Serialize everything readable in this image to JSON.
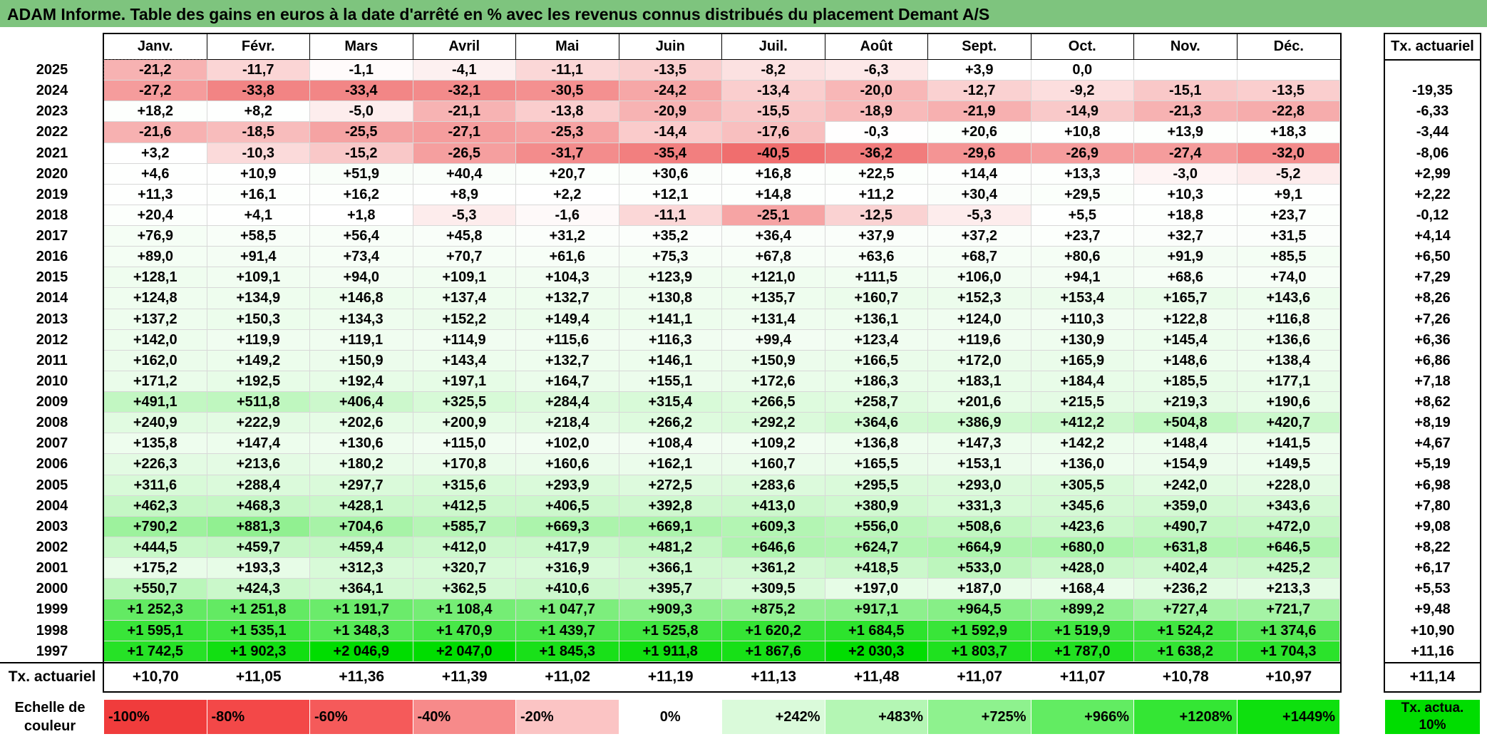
{
  "title": "ADAM Informe. Table des gains en euros à la date d'arrêté en % avec les revenus connus distribués du placement Demant A/S",
  "months": [
    "Janv.",
    "Févr.",
    "Mars",
    "Avril",
    "Mai",
    "Juin",
    "Juil.",
    "Août",
    "Sept.",
    "Oct.",
    "Nov.",
    "Déc."
  ],
  "tx_header": "Tx. actuariel",
  "rows": [
    {
      "year": "2025",
      "cells": [
        "-21,2",
        "-11,7",
        "-1,1",
        "-4,1",
        "-11,1",
        "-13,5",
        "-8,2",
        "-6,3",
        "+3,9",
        "0,0",
        "",
        ""
      ],
      "tx": ""
    },
    {
      "year": "2024",
      "cells": [
        "-27,2",
        "-33,8",
        "-33,4",
        "-32,1",
        "-30,5",
        "-24,2",
        "-13,4",
        "-20,0",
        "-12,7",
        "-9,2",
        "-15,1",
        "-13,5"
      ],
      "tx": "-19,35"
    },
    {
      "year": "2023",
      "cells": [
        "+18,2",
        "+8,2",
        "-5,0",
        "-21,1",
        "-13,8",
        "-20,9",
        "-15,5",
        "-18,9",
        "-21,9",
        "-14,9",
        "-21,3",
        "-22,8"
      ],
      "tx": "-6,33"
    },
    {
      "year": "2022",
      "cells": [
        "-21,6",
        "-18,5",
        "-25,5",
        "-27,1",
        "-25,3",
        "-14,4",
        "-17,6",
        "-0,3",
        "+20,6",
        "+10,8",
        "+13,9",
        "+18,3"
      ],
      "tx": "-3,44"
    },
    {
      "year": "2021",
      "cells": [
        "+3,2",
        "-10,3",
        "-15,2",
        "-26,5",
        "-31,7",
        "-35,4",
        "-40,5",
        "-36,2",
        "-29,6",
        "-26,9",
        "-27,4",
        "-32,0"
      ],
      "tx": "-8,06"
    },
    {
      "year": "2020",
      "cells": [
        "+4,6",
        "+10,9",
        "+51,9",
        "+40,4",
        "+20,7",
        "+30,6",
        "+16,8",
        "+22,5",
        "+14,4",
        "+13,3",
        "-3,0",
        "-5,2"
      ],
      "tx": "+2,99"
    },
    {
      "year": "2019",
      "cells": [
        "+11,3",
        "+16,1",
        "+16,2",
        "+8,9",
        "+2,2",
        "+12,1",
        "+14,8",
        "+11,2",
        "+30,4",
        "+29,5",
        "+10,3",
        "+9,1"
      ],
      "tx": "+2,22"
    },
    {
      "year": "2018",
      "cells": [
        "+20,4",
        "+4,1",
        "+1,8",
        "-5,3",
        "-1,6",
        "-11,1",
        "-25,1",
        "-12,5",
        "-5,3",
        "+5,5",
        "+18,8",
        "+23,7"
      ],
      "tx": "-0,12"
    },
    {
      "year": "2017",
      "cells": [
        "+76,9",
        "+58,5",
        "+56,4",
        "+45,8",
        "+31,2",
        "+35,2",
        "+36,4",
        "+37,9",
        "+37,2",
        "+23,7",
        "+32,7",
        "+31,5"
      ],
      "tx": "+4,14"
    },
    {
      "year": "2016",
      "cells": [
        "+89,0",
        "+91,4",
        "+73,4",
        "+70,7",
        "+61,6",
        "+75,3",
        "+67,8",
        "+63,6",
        "+68,7",
        "+80,6",
        "+91,9",
        "+85,5"
      ],
      "tx": "+6,50"
    },
    {
      "year": "2015",
      "cells": [
        "+128,1",
        "+109,1",
        "+94,0",
        "+109,1",
        "+104,3",
        "+123,9",
        "+121,0",
        "+111,5",
        "+106,0",
        "+94,1",
        "+68,6",
        "+74,0"
      ],
      "tx": "+7,29"
    },
    {
      "year": "2014",
      "cells": [
        "+124,8",
        "+134,9",
        "+146,8",
        "+137,4",
        "+132,7",
        "+130,8",
        "+135,7",
        "+160,7",
        "+152,3",
        "+153,4",
        "+165,7",
        "+143,6"
      ],
      "tx": "+8,26"
    },
    {
      "year": "2013",
      "cells": [
        "+137,2",
        "+150,3",
        "+134,3",
        "+152,2",
        "+149,4",
        "+141,1",
        "+131,4",
        "+136,1",
        "+124,0",
        "+110,3",
        "+122,8",
        "+116,8"
      ],
      "tx": "+7,26"
    },
    {
      "year": "2012",
      "cells": [
        "+142,0",
        "+119,9",
        "+119,1",
        "+114,9",
        "+115,6",
        "+116,3",
        "+99,4",
        "+123,4",
        "+119,6",
        "+130,9",
        "+145,4",
        "+136,6"
      ],
      "tx": "+6,36"
    },
    {
      "year": "2011",
      "cells": [
        "+162,0",
        "+149,2",
        "+150,9",
        "+143,4",
        "+132,7",
        "+146,1",
        "+150,9",
        "+166,5",
        "+172,0",
        "+165,9",
        "+148,6",
        "+138,4"
      ],
      "tx": "+6,86"
    },
    {
      "year": "2010",
      "cells": [
        "+171,2",
        "+192,5",
        "+192,4",
        "+197,1",
        "+164,7",
        "+155,1",
        "+172,6",
        "+186,3",
        "+183,1",
        "+184,4",
        "+185,5",
        "+177,1"
      ],
      "tx": "+7,18"
    },
    {
      "year": "2009",
      "cells": [
        "+491,1",
        "+511,8",
        "+406,4",
        "+325,5",
        "+284,4",
        "+315,4",
        "+266,5",
        "+258,7",
        "+201,6",
        "+215,5",
        "+219,3",
        "+190,6"
      ],
      "tx": "+8,62"
    },
    {
      "year": "2008",
      "cells": [
        "+240,9",
        "+222,9",
        "+202,6",
        "+200,9",
        "+218,4",
        "+266,2",
        "+292,2",
        "+364,6",
        "+386,9",
        "+412,2",
        "+504,8",
        "+420,7"
      ],
      "tx": "+8,19"
    },
    {
      "year": "2007",
      "cells": [
        "+135,8",
        "+147,4",
        "+130,6",
        "+115,0",
        "+102,0",
        "+108,4",
        "+109,2",
        "+136,8",
        "+147,3",
        "+142,2",
        "+148,4",
        "+141,5"
      ],
      "tx": "+4,67"
    },
    {
      "year": "2006",
      "cells": [
        "+226,3",
        "+213,6",
        "+180,2",
        "+170,8",
        "+160,6",
        "+162,1",
        "+160,7",
        "+165,5",
        "+153,1",
        "+136,0",
        "+154,9",
        "+149,5"
      ],
      "tx": "+5,19"
    },
    {
      "year": "2005",
      "cells": [
        "+311,6",
        "+288,4",
        "+297,7",
        "+315,6",
        "+293,9",
        "+272,5",
        "+283,6",
        "+295,5",
        "+293,0",
        "+305,5",
        "+242,0",
        "+228,0"
      ],
      "tx": "+6,98"
    },
    {
      "year": "2004",
      "cells": [
        "+462,3",
        "+468,3",
        "+428,1",
        "+412,5",
        "+406,5",
        "+392,8",
        "+413,0",
        "+380,9",
        "+331,3",
        "+345,6",
        "+359,0",
        "+343,6"
      ],
      "tx": "+7,80"
    },
    {
      "year": "2003",
      "cells": [
        "+790,2",
        "+881,3",
        "+704,6",
        "+585,7",
        "+669,3",
        "+669,1",
        "+609,3",
        "+556,0",
        "+508,6",
        "+423,6",
        "+490,7",
        "+472,0"
      ],
      "tx": "+9,08"
    },
    {
      "year": "2002",
      "cells": [
        "+444,5",
        "+459,7",
        "+459,4",
        "+412,0",
        "+417,9",
        "+481,2",
        "+646,6",
        "+624,7",
        "+664,9",
        "+680,0",
        "+631,8",
        "+646,5"
      ],
      "tx": "+8,22"
    },
    {
      "year": "2001",
      "cells": [
        "+175,2",
        "+193,3",
        "+312,3",
        "+320,7",
        "+316,9",
        "+366,1",
        "+361,2",
        "+418,5",
        "+533,0",
        "+428,0",
        "+402,4",
        "+425,2"
      ],
      "tx": "+6,17"
    },
    {
      "year": "2000",
      "cells": [
        "+550,7",
        "+424,3",
        "+364,1",
        "+362,5",
        "+410,6",
        "+395,7",
        "+309,5",
        "+197,0",
        "+187,0",
        "+168,4",
        "+236,2",
        "+213,3"
      ],
      "tx": "+5,53"
    },
    {
      "year": "1999",
      "cells": [
        "+1 252,3",
        "+1 251,8",
        "+1 191,7",
        "+1 108,4",
        "+1 047,7",
        "+909,3",
        "+875,2",
        "+917,1",
        "+964,5",
        "+899,2",
        "+727,4",
        "+721,7"
      ],
      "tx": "+9,48"
    },
    {
      "year": "1998",
      "cells": [
        "+1 595,1",
        "+1 535,1",
        "+1 348,3",
        "+1 470,9",
        "+1 439,7",
        "+1 525,8",
        "+1 620,2",
        "+1 684,5",
        "+1 592,9",
        "+1 519,9",
        "+1 524,2",
        "+1 374,6"
      ],
      "tx": "+10,90"
    },
    {
      "year": "1997",
      "cells": [
        "+1 742,5",
        "+1 902,3",
        "+2 046,9",
        "+2 047,0",
        "+1 845,3",
        "+1 911,8",
        "+1 867,6",
        "+2 030,3",
        "+1 803,7",
        "+1 787,0",
        "+1 638,2",
        "+1 704,3"
      ],
      "tx": "+11,16"
    }
  ],
  "summary": {
    "label": "Tx. actuariel",
    "cells": [
      "+10,70",
      "+11,05",
      "+11,36",
      "+11,39",
      "+11,02",
      "+11,19",
      "+11,13",
      "+11,48",
      "+11,07",
      "+11,07",
      "+10,78",
      "+10,97"
    ],
    "total": "+11,14"
  },
  "scale": {
    "label": "Echelle de couleur",
    "items": [
      {
        "text": "-100%",
        "bg": "#f03c3c"
      },
      {
        "text": "-80%",
        "bg": "#f34848"
      },
      {
        "text": "-60%",
        "bg": "#f55a5a"
      },
      {
        "text": "-40%",
        "bg": "#f78a8a"
      },
      {
        "text": "-20%",
        "bg": "#fbc4c4"
      },
      {
        "text": "0%",
        "bg": "#ffffff"
      },
      {
        "text": "+242%",
        "bg": "#dafada"
      },
      {
        "text": "+483%",
        "bg": "#b4f6b4"
      },
      {
        "text": "+725%",
        "bg": "#8ef28e"
      },
      {
        "text": "+966%",
        "bg": "#62ec62"
      },
      {
        "text": "+1208%",
        "bg": "#34e634"
      },
      {
        "text": "+1449%",
        "bg": "#0ee00e"
      }
    ],
    "tx_label": "Tx. actua. 10%",
    "tx_bg": "#00dd00"
  },
  "colors": {
    "title_bar": "#7ec47e",
    "negative_max": "#f03c3c",
    "positive_max": "#00dd00"
  }
}
